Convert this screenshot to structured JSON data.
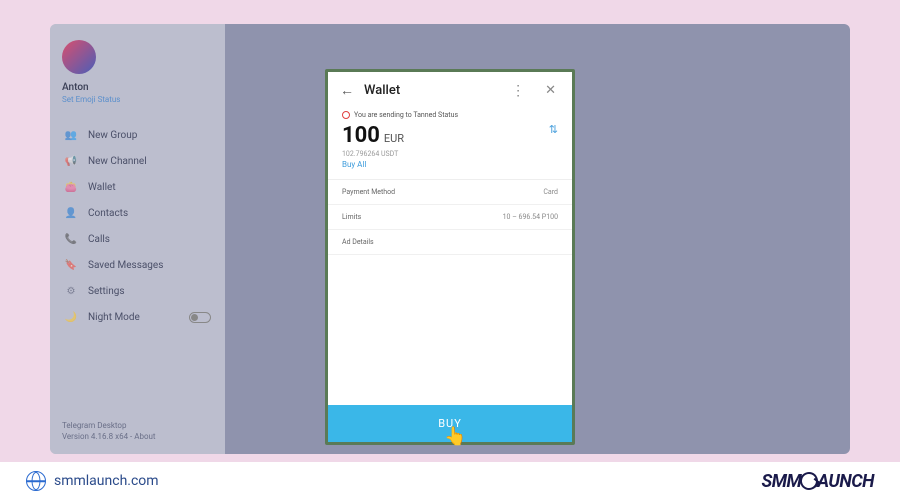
{
  "sidebar": {
    "username": "Anton",
    "status": "Set Emoji Status",
    "items": [
      {
        "icon": "👥",
        "label": "New Group"
      },
      {
        "icon": "📢",
        "label": "New Channel"
      },
      {
        "icon": "👛",
        "label": "Wallet"
      },
      {
        "icon": "👤",
        "label": "Contacts"
      },
      {
        "icon": "📞",
        "label": "Calls"
      },
      {
        "icon": "🔖",
        "label": "Saved Messages"
      },
      {
        "icon": "⚙",
        "label": "Settings"
      },
      {
        "icon": "🌙",
        "label": "Night Mode"
      }
    ],
    "footer_line1": "Telegram Desktop",
    "footer_line2": "Version 4.16.8 x64 - About"
  },
  "modal": {
    "title": "Wallet",
    "notice": "You are sending to Tanned Status",
    "amount": "100",
    "currency": "EUR",
    "sub_amount": "102.796264 USDT",
    "link": "Buy All",
    "rows": [
      {
        "label": "Payment Method",
        "value": "Card"
      },
      {
        "label": "Limits",
        "value": "10 – 696.54 P100"
      },
      {
        "label": "Ad Details",
        "value": ""
      }
    ],
    "button": "BUY"
  },
  "footer": {
    "site": "smmlaunch.com",
    "brand_left": "SMM",
    "brand_right": "AUNCH"
  }
}
